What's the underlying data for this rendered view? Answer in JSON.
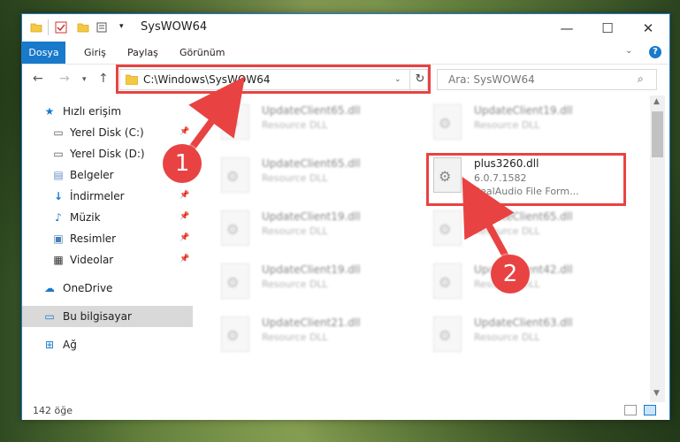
{
  "window": {
    "title": "SysWOW64",
    "controls": {
      "minimize": "—",
      "maximize": "☐",
      "close": "✕"
    }
  },
  "ribbon": {
    "tabs": [
      "Dosya",
      "Giriş",
      "Paylaş",
      "Görünüm"
    ],
    "help": "?"
  },
  "navigation": {
    "address": "C:\\Windows\\SysWOW64",
    "search_placeholder": "Ara: SysWOW64"
  },
  "sidebar": {
    "items": [
      {
        "label": "Hızlı erişim",
        "icon": "star-icon",
        "pinned": false
      },
      {
        "label": "Yerel Disk (C:)",
        "icon": "drive-icon",
        "pinned": true
      },
      {
        "label": "Yerel Disk (D:)",
        "icon": "drive-icon",
        "pinned": false
      },
      {
        "label": "Belgeler",
        "icon": "documents-icon",
        "pinned": true
      },
      {
        "label": "İndirmeler",
        "icon": "download-icon",
        "pinned": true
      },
      {
        "label": "Müzik",
        "icon": "music-icon",
        "pinned": true
      },
      {
        "label": "Resimler",
        "icon": "pictures-icon",
        "pinned": true
      },
      {
        "label": "Videolar",
        "icon": "video-icon",
        "pinned": true
      },
      {
        "label": "OneDrive",
        "icon": "cloud-icon",
        "pinned": false
      },
      {
        "label": "Bu bilgisayar",
        "icon": "computer-icon",
        "pinned": false,
        "selected": true
      },
      {
        "label": "Ağ",
        "icon": "network-icon",
        "pinned": false
      }
    ]
  },
  "files": {
    "highlighted": {
      "name": "plus3260.dll",
      "version": "6.0.7.1582",
      "description": "RealAudio File Form..."
    },
    "blurred_left": [
      {
        "name": "UpdateClient65.dll",
        "type": "Resource DLL"
      },
      {
        "name": "UpdateClient65.dll",
        "type": "Resource DLL"
      },
      {
        "name": "UpdateClient19.dll",
        "type": "Resource DLL"
      },
      {
        "name": "UpdateClient19.dll",
        "type": "Resource DLL"
      },
      {
        "name": "UpdateClient21.dll",
        "type": "Resource DLL"
      }
    ],
    "blurred_right": [
      {
        "name": "UpdateClient19.dll",
        "type": "Resource DLL"
      },
      {
        "name": "UpdateClient65.dll",
        "type": "Resource DLL"
      },
      {
        "name": "UpdateClient42.dll",
        "type": "Resource DLL"
      },
      {
        "name": "UpdateClient63.dll",
        "type": "Resource DLL"
      }
    ]
  },
  "status": {
    "item_count": "142 öğe"
  },
  "annotations": {
    "step1": "1",
    "step2": "2",
    "color": "#e84342"
  }
}
